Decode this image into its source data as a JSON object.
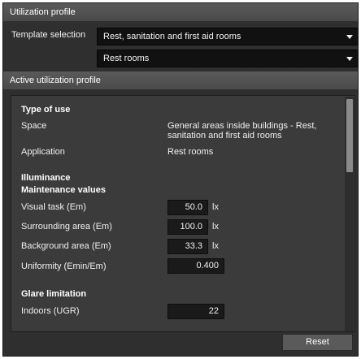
{
  "utilization_header": "Utilization profile",
  "template_selection_label": "Template selection",
  "template_combo": {
    "value": "Rest, sanitation and first aid rooms"
  },
  "room_combo": {
    "value": "Rest rooms"
  },
  "active_header": "Active utilization profile",
  "type_of_use": {
    "heading": "Type of use",
    "space_label": "Space",
    "space_value_line1": "General areas inside buildings - Rest,",
    "space_value_line2": "sanitation and first aid rooms",
    "application_label": "Application",
    "application_value": "Rest rooms"
  },
  "illuminance": {
    "heading": "Illuminance",
    "subheading": "Maintenance values",
    "visual_task_label": "Visual task (Em)",
    "visual_task_value": "50.0",
    "surrounding_label": "Surrounding area (Em)",
    "surrounding_value": "100.0",
    "background_label": "Background area (Em)",
    "background_value": "33.3",
    "unit": "lx",
    "uniformity_label": "Uniformity (Emin/Em)",
    "uniformity_value": "0.400"
  },
  "glare": {
    "heading": "Glare limitation",
    "indoors_label": "Indoors (UGR)",
    "indoors_value": "22"
  },
  "reset_label": "Reset"
}
